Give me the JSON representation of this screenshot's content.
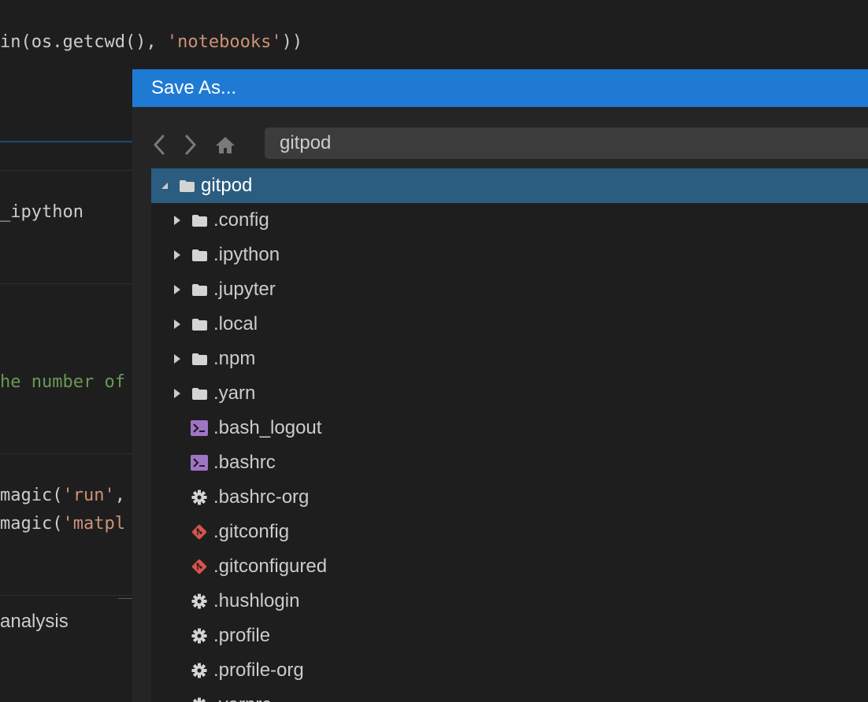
{
  "editor": {
    "code_line1_prefix": "in(os.getcwd(), ",
    "code_line1_string": "'notebooks'",
    "code_line1_suffix": "))",
    "code_line2": "_ipython",
    "code_line3_comment": "he number of",
    "code_line4_prefix": "magic(",
    "code_line4_string": "'run'",
    "code_line4_suffix": ",",
    "code_line5_prefix": "magic(",
    "code_line5_string": "'matpl",
    "markdown_text": "analysis"
  },
  "dialog": {
    "title": "Save As...",
    "path_value": "gitpod",
    "tree": [
      {
        "label": "gitpod",
        "kind": "folder",
        "depth": 0,
        "expanded": true,
        "selected": true
      },
      {
        "label": ".config",
        "kind": "folder",
        "depth": 1
      },
      {
        "label": ".ipython",
        "kind": "folder",
        "depth": 1
      },
      {
        "label": ".jupyter",
        "kind": "folder",
        "depth": 1
      },
      {
        "label": ".local",
        "kind": "folder",
        "depth": 1
      },
      {
        "label": ".npm",
        "kind": "folder",
        "depth": 1
      },
      {
        "label": ".yarn",
        "kind": "folder",
        "depth": 1
      },
      {
        "label": ".bash_logout",
        "kind": "terminal-file",
        "depth": 1
      },
      {
        "label": ".bashrc",
        "kind": "terminal-file",
        "depth": 1
      },
      {
        "label": ".bashrc-org",
        "kind": "gear-file",
        "depth": 1
      },
      {
        "label": ".gitconfig",
        "kind": "git-file",
        "depth": 1
      },
      {
        "label": ".gitconfigured",
        "kind": "git-file",
        "depth": 1
      },
      {
        "label": ".hushlogin",
        "kind": "gear-file",
        "depth": 1
      },
      {
        "label": ".profile",
        "kind": "gear-file",
        "depth": 1
      },
      {
        "label": ".profile-org",
        "kind": "gear-file",
        "depth": 1
      },
      {
        "label": ".yarnrc",
        "kind": "gear-file",
        "depth": 1
      }
    ]
  },
  "icons": {
    "back": "chevron-left-icon",
    "forward": "chevron-right-icon",
    "home": "home-icon",
    "folder": "folder-icon",
    "terminal-file": "terminal-file-icon",
    "gear-file": "gear-icon",
    "git-file": "git-icon"
  },
  "colors": {
    "title_bar": "#1f7ad4",
    "selected_row": "#2b5d80",
    "terminal_icon": "#a074c4",
    "git_icon": "#d9534f"
  }
}
